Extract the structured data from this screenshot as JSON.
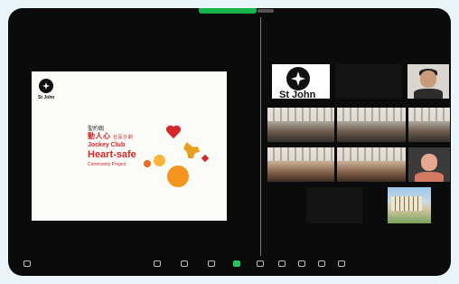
{
  "slide": {
    "logo_text": "St John",
    "title_cn1": "聖約翰",
    "title_cn2": "動人心",
    "title_cn2_suffix": "社區計劃",
    "title_en1": "Jockey Club",
    "title_en2": "Heart-safe",
    "title_en3": "Community Project"
  },
  "gallery": {
    "logo_tile_text": "St John"
  },
  "colors": {
    "accent_green": "#17b34a",
    "slide_red": "#d4282b",
    "slide_orange": "#f5941d"
  }
}
